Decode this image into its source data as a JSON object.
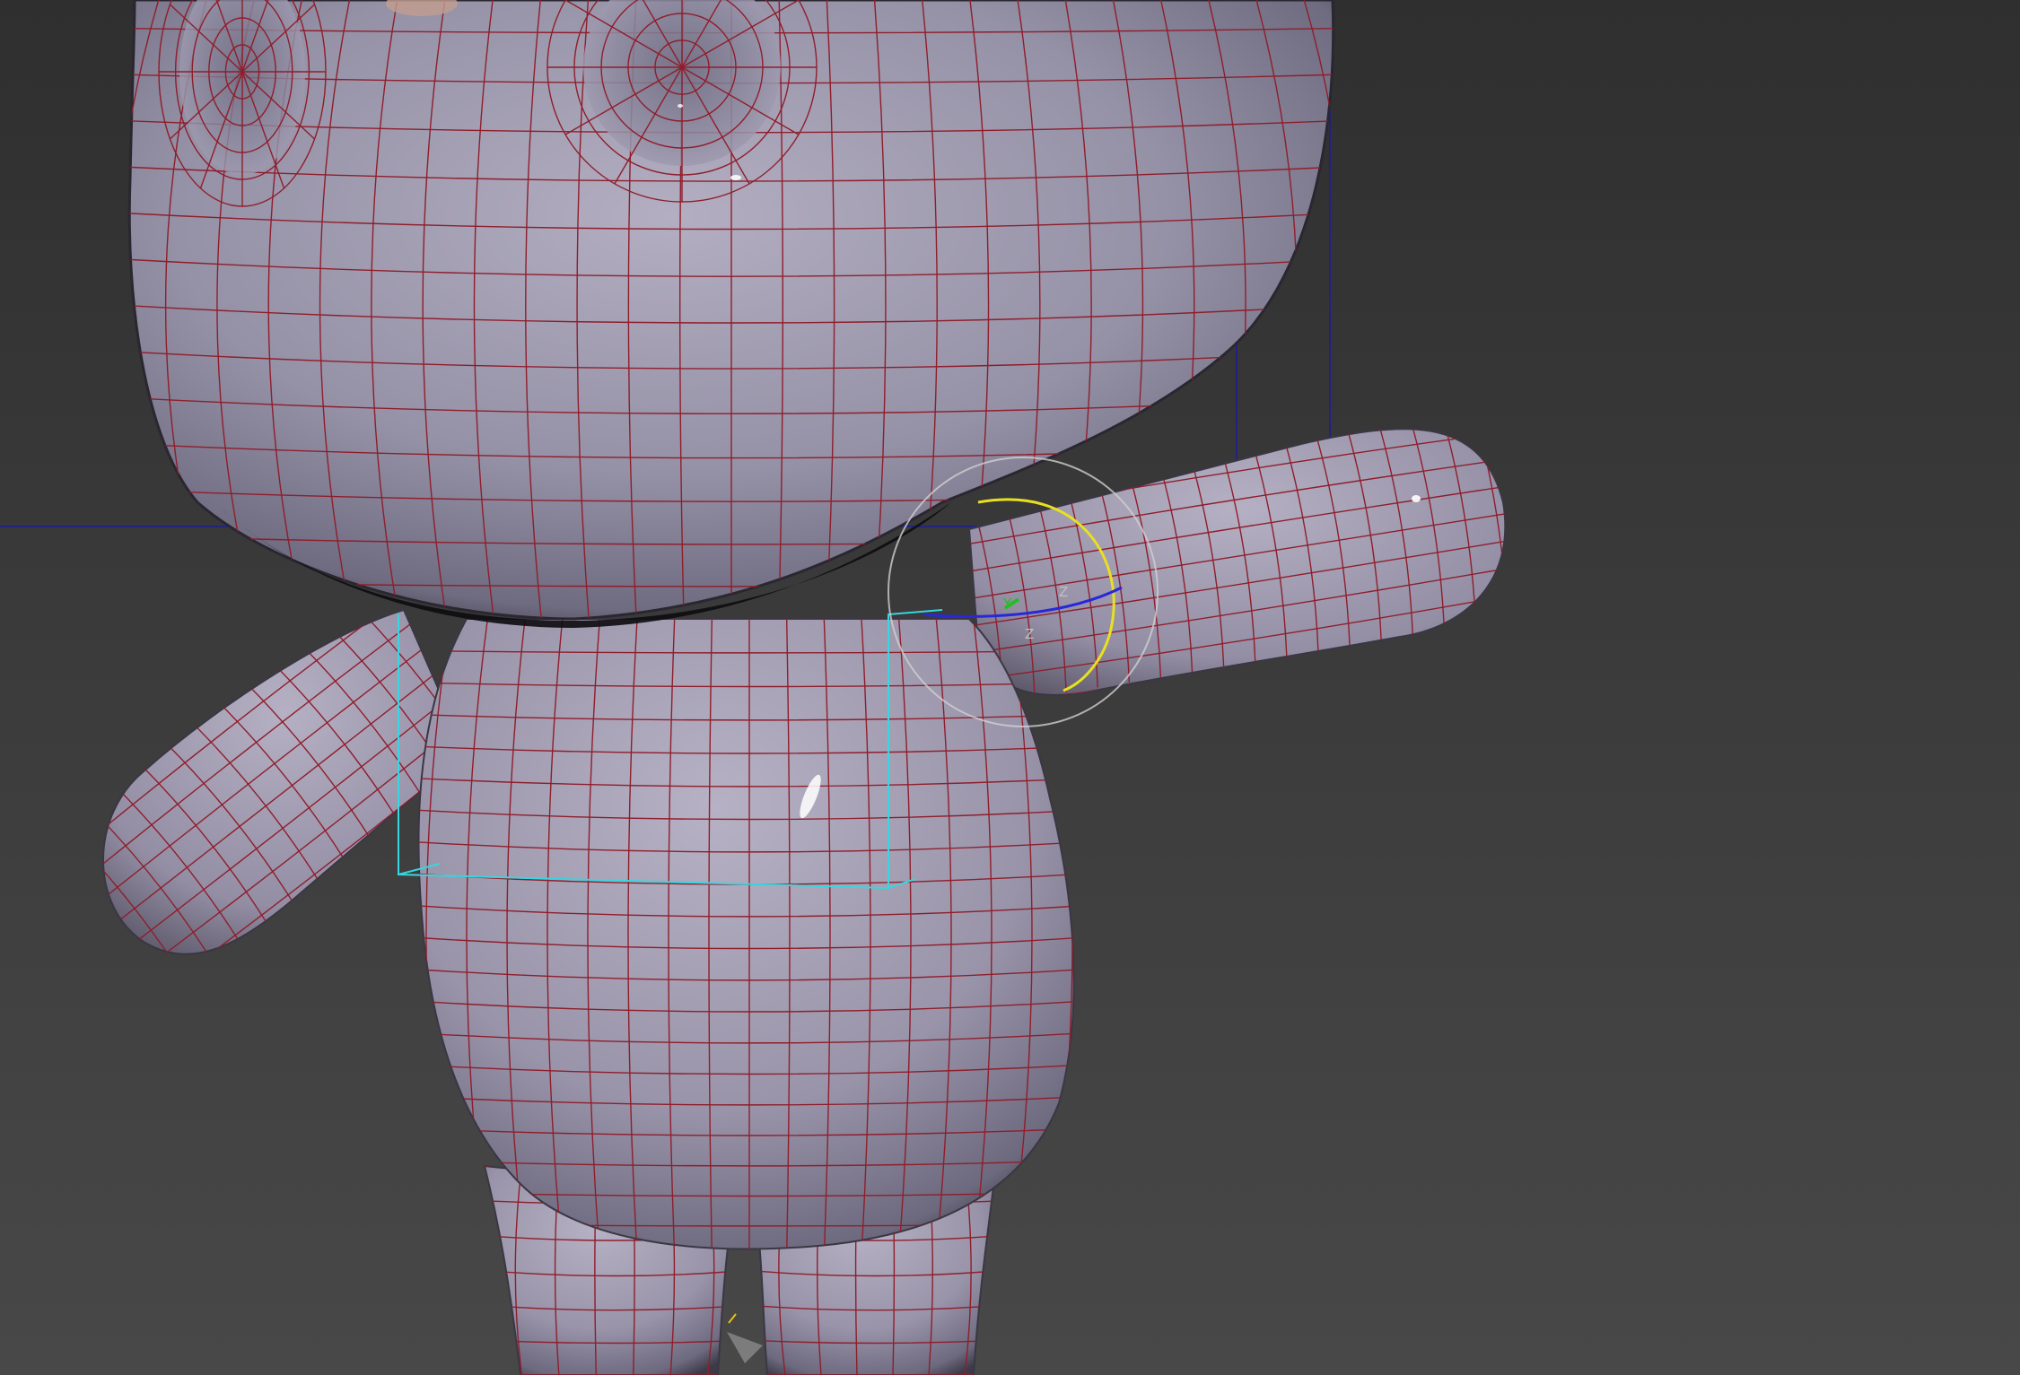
{
  "viewport": {
    "background_top": "#2f2f2f",
    "background_bottom": "#484848",
    "mesh_fill": "#9c98ad",
    "mesh_highlight": "#dcd8e6",
    "mesh_shadow": "#4a4656",
    "wire_color": "#8f1e2c",
    "blue_grid_color": "#1c1c9a",
    "cyan_bounds_color": "#37d6e0"
  },
  "gizmo": {
    "type": "rotate",
    "icon": "rotate-gizmo-icon",
    "axis_x": "Z",
    "axis_y": "Y",
    "axis_z": "Z",
    "x_color": "#2828d8",
    "y_color": "#e8e020",
    "z_color": "#20c020",
    "outer_color": "#d0d0d0"
  }
}
